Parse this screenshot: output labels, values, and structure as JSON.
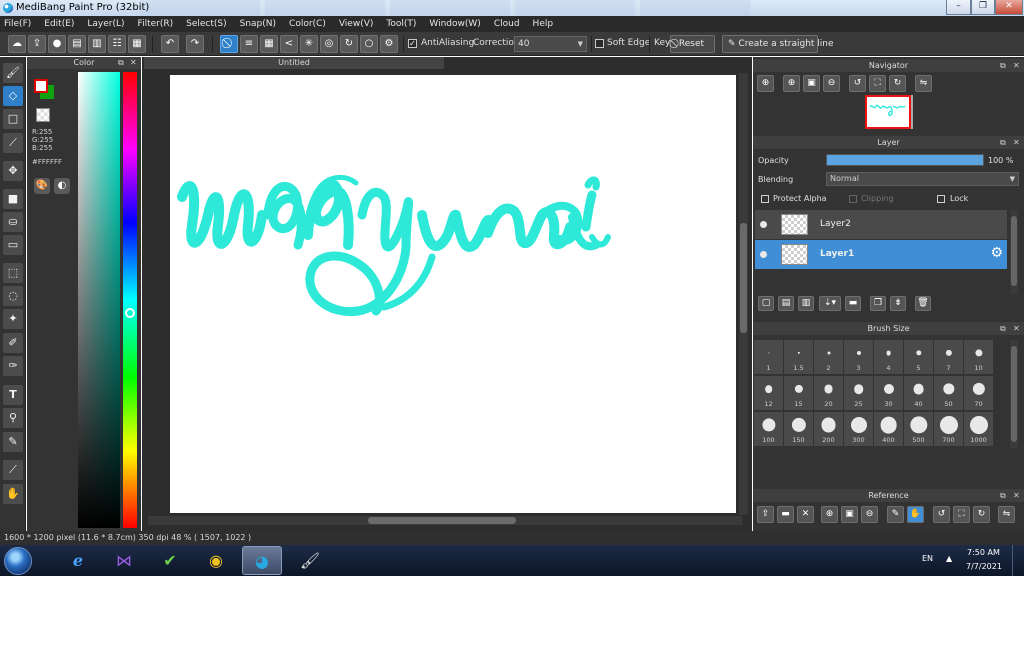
{
  "window": {
    "title": "MediBang Paint Pro (32bit)",
    "controls": [
      "–",
      "❐",
      "✕"
    ]
  },
  "menu": [
    "File(F)",
    "Edit(E)",
    "Layer(L)",
    "Filter(R)",
    "Select(S)",
    "Snap(N)",
    "Color(C)",
    "View(V)",
    "Tool(T)",
    "Window(W)",
    "Cloud",
    "Help"
  ],
  "toolbar": {
    "antialiasing_label": "AntiAliasing",
    "antialiasing_checked": true,
    "correction_label": "Correction",
    "correction_value": "40",
    "soft_edge_label": "Soft Edge",
    "soft_edge_checked": false,
    "key_label": "Key",
    "reset_label": "Reset",
    "straight_line_label": "Create a straight line"
  },
  "color_panel": {
    "title": "Color",
    "r": "R:255",
    "g": "G:255",
    "b": "B:255",
    "hex": "#FFFFFF",
    "foreground": "#ffffff",
    "background": "#10a010"
  },
  "canvas": {
    "tab_title": "Untitled",
    "stroke_color": "#2ee8d8"
  },
  "navigator": {
    "title": "Navigator"
  },
  "layer_panel": {
    "title": "Layer",
    "opacity_label": "Opacity",
    "opacity_value": "100 %",
    "opacity": 1.0,
    "blending_label": "Blending",
    "blending_value": "Normal",
    "protect_alpha_label": "Protect Alpha",
    "clipping_label": "Clipping",
    "lock_label": "Lock",
    "layers": [
      {
        "name": "Layer2",
        "selected": false
      },
      {
        "name": "Layer1",
        "selected": true
      }
    ]
  },
  "brush_size": {
    "title": "Brush Size",
    "sizes": [
      "1",
      "1.5",
      "2",
      "3",
      "4",
      "5",
      "7",
      "10",
      "12",
      "15",
      "20",
      "25",
      "30",
      "40",
      "50",
      "70",
      "100",
      "150",
      "200",
      "300",
      "400",
      "500",
      "700",
      "1000"
    ]
  },
  "reference": {
    "title": "Reference"
  },
  "status": {
    "text": "1600 * 1200 pixel   (11.6 * 8.7cm)   350 dpi   48 %   ( 1507, 1022 )"
  },
  "taskbar": {
    "language": "EN",
    "time": "7:50 AM",
    "date": "7/7/2021"
  },
  "colors": {
    "accent": "#3f8ed6",
    "panel_bg": "#333333"
  }
}
